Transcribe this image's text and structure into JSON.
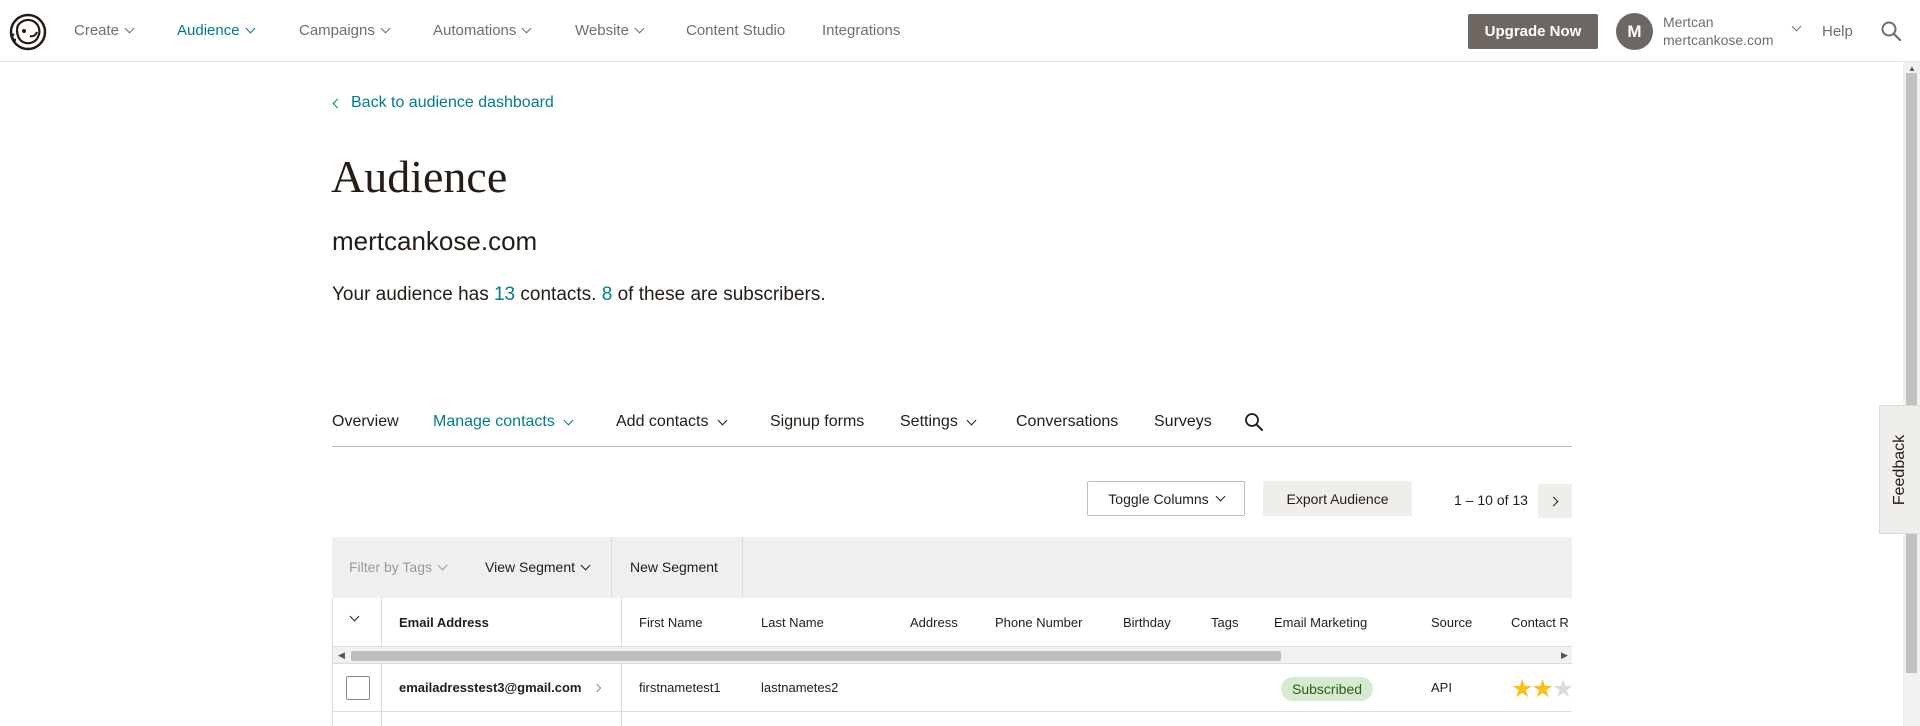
{
  "topnav": {
    "items": [
      {
        "label": "Create",
        "has_dropdown": true
      },
      {
        "label": "Audience",
        "has_dropdown": true,
        "active": true
      },
      {
        "label": "Campaigns",
        "has_dropdown": true
      },
      {
        "label": "Automations",
        "has_dropdown": true
      },
      {
        "label": "Website",
        "has_dropdown": true
      },
      {
        "label": "Content Studio",
        "has_dropdown": false
      },
      {
        "label": "Integrations",
        "has_dropdown": false
      }
    ],
    "upgrade_label": "Upgrade Now",
    "avatar_initial": "M",
    "account_name": "Mertcan",
    "account_domain": "mertcankose.com",
    "help_label": "Help"
  },
  "page": {
    "back_link": "Back to audience dashboard",
    "title": "Audience",
    "audience_name": "mertcankose.com",
    "summary": {
      "prefix": "Your audience has ",
      "contacts": "13",
      "middle": " contacts. ",
      "subscribers": "8",
      "suffix": " of these are subscribers."
    }
  },
  "tabs": [
    {
      "label": "Overview"
    },
    {
      "label": "Manage contacts",
      "active": true
    },
    {
      "label": "Add contacts"
    },
    {
      "label": "Signup forms"
    },
    {
      "label": "Settings"
    },
    {
      "label": "Conversations"
    },
    {
      "label": "Surveys"
    }
  ],
  "toolbar": {
    "toggle_columns": "Toggle Columns",
    "export": "Export Audience",
    "pager": "1 – 10 of 13"
  },
  "filterbar": {
    "filter_tags": "Filter by Tags",
    "view_segment": "View Segment",
    "new_segment": "New Segment"
  },
  "table": {
    "columns": [
      "Email Address",
      "First Name",
      "Last Name",
      "Address",
      "Phone Number",
      "Birthday",
      "Tags",
      "Email Marketing",
      "Source",
      "Contact R"
    ],
    "rows": [
      {
        "email": "emailadresstest3@gmail.com",
        "first_name": "firstnametest1",
        "last_name": "lastnametes2",
        "address": "",
        "phone": "",
        "birthday": "",
        "tags": "",
        "email_marketing": "Subscribed",
        "source": "API",
        "rating": 2,
        "rating_max": 5
      }
    ]
  },
  "feedback_label": "Feedback",
  "colors": {
    "accent": "#007c89",
    "upgrade_bg": "#6e6661",
    "subscribed_bg": "#d4ebcd",
    "star": "#f6c11d"
  }
}
